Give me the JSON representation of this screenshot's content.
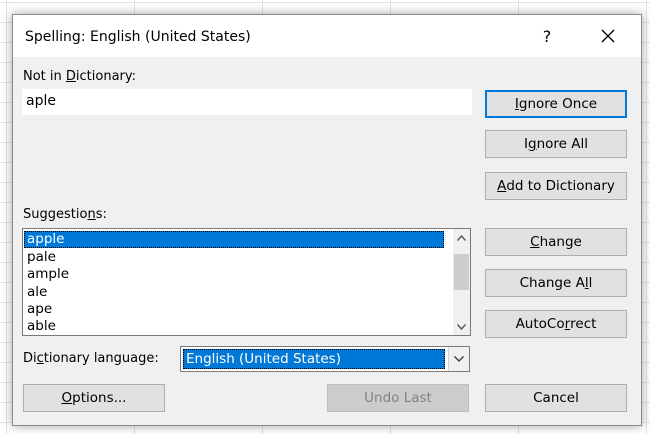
{
  "dialog": {
    "title": "Spelling: English (United States)",
    "help": "?",
    "not_in_dictionary_label": {
      "pre": "Not in ",
      "key": "D",
      "post": "ictionary:"
    },
    "not_in_dictionary_value": "aple",
    "suggestions_label": {
      "pre": "Suggestio",
      "key": "n",
      "post": "s:"
    },
    "suggestions": [
      "apple",
      "pale",
      "ample",
      "ale",
      "ape",
      "able"
    ],
    "selected_suggestion": "apple",
    "dictionary_language_label": {
      "pre": "Di",
      "key": "c",
      "post": "tionary language:"
    },
    "dictionary_language": "English (United States)",
    "buttons": {
      "ignore_once": {
        "key": "I",
        "post": "gnore Once"
      },
      "ignore_all": {
        "pre": "I",
        "key": "g",
        "post": "nore All"
      },
      "add_to_dictionary": {
        "key": "A",
        "post": "dd to Dictionary"
      },
      "change": {
        "key": "C",
        "post": "hange"
      },
      "change_all": {
        "pre": "Change A",
        "key": "l",
        "post": "l"
      },
      "autocorrect": {
        "pre": "AutoCo",
        "key": "r",
        "post": "rect"
      },
      "options": {
        "key": "O",
        "post": "ptions..."
      },
      "undo_last": "Undo Last",
      "cancel": "Cancel"
    }
  },
  "colors": {
    "dialog_bg": "#f0f0f0",
    "selection": "#0078d7",
    "default_button_border": "#0078d7",
    "button_bg": "#e1e1e1"
  }
}
